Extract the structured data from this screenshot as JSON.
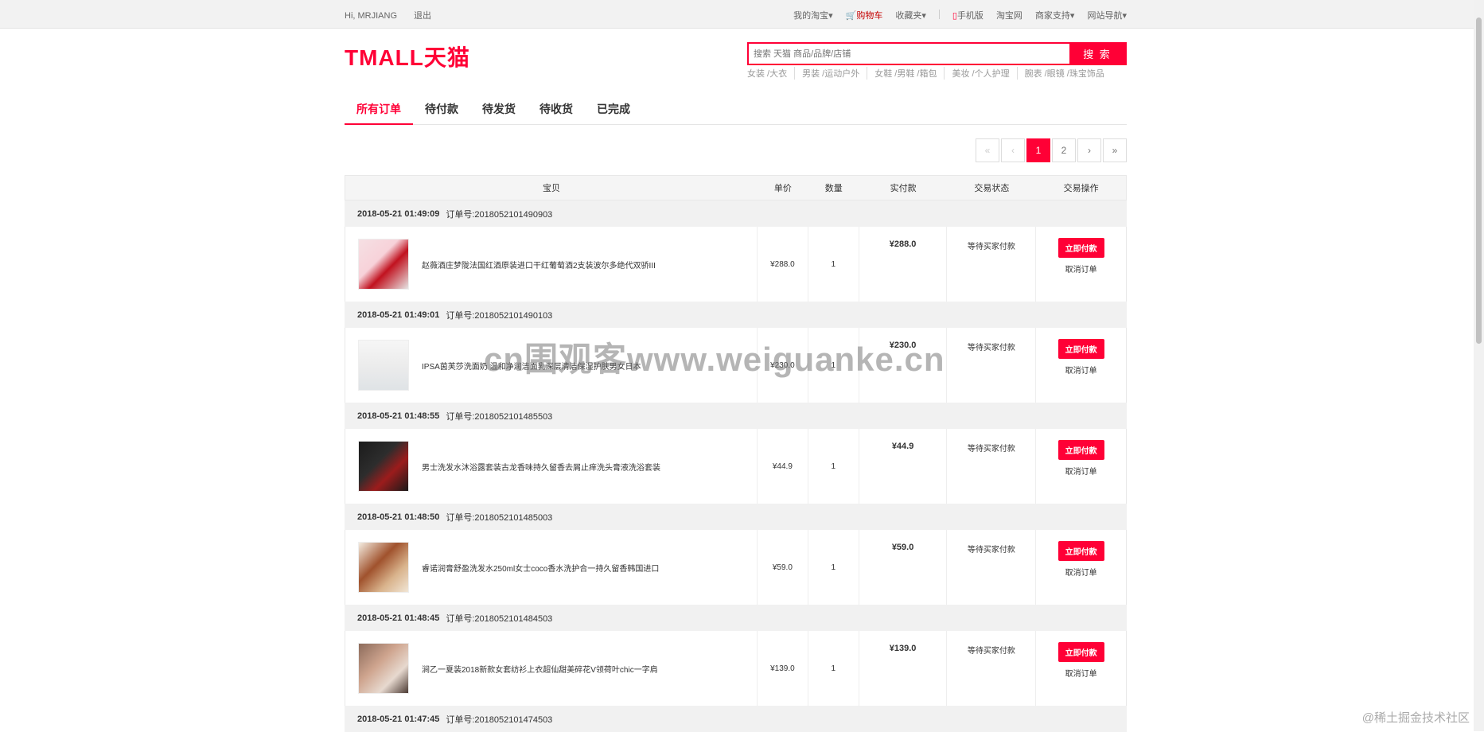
{
  "topbar": {
    "greeting": "Hi, MRJIANG",
    "logout": "退出",
    "links": [
      "我的淘宝▾",
      "购物车",
      "收藏夹▾",
      "手机版",
      "淘宝网",
      "商家支持▾",
      "网站导航▾"
    ]
  },
  "header": {
    "logo": "TMALL天猫",
    "search_placeholder": "搜索 天猫 商品/品牌/店铺",
    "search_button": "搜 索",
    "hotwords": [
      "女装 /大衣",
      "男装 /运动户外",
      "女鞋 /男鞋 /箱包",
      "美妆 /个人护理",
      "腕表 /眼镜 /珠宝饰品"
    ]
  },
  "tabs": [
    "所有订单",
    "待付款",
    "待发货",
    "待收货",
    "已完成"
  ],
  "pagination": [
    "«",
    "‹",
    "1",
    "2",
    "›",
    "»"
  ],
  "table": {
    "headers": [
      "宝贝",
      "单价",
      "数量",
      "实付款",
      "交易状态",
      "交易操作"
    ]
  },
  "orders": [
    {
      "time": "2018-05-21 01:49:09",
      "order_no": "订单号:2018052101490903",
      "title": "赵薇酒庄梦陇法国红酒原装进口干红葡萄酒2支装波尔多绝代双骄III",
      "price": "¥288.0",
      "qty": "1",
      "paid": "¥288.0",
      "status": "等待买家付款",
      "pay_button": "立即付款",
      "cancel": "取消订单"
    },
    {
      "time": "2018-05-21 01:49:01",
      "order_no": "订单号:2018052101490103",
      "title": "IPSA茵芙莎洗面奶 温和净润洁面乳深层清洁保湿护肤男女日本",
      "price": "¥230.0",
      "qty": "1",
      "paid": "¥230.0",
      "status": "等待买家付款",
      "pay_button": "立即付款",
      "cancel": "取消订单"
    },
    {
      "time": "2018-05-21 01:48:55",
      "order_no": "订单号:2018052101485503",
      "title": "男士洗发水沐浴露套装古龙香味持久留香去屑止痒洗头膏液洗浴套装",
      "price": "¥44.9",
      "qty": "1",
      "paid": "¥44.9",
      "status": "等待买家付款",
      "pay_button": "立即付款",
      "cancel": "取消订单"
    },
    {
      "time": "2018-05-21 01:48:50",
      "order_no": "订单号:2018052101485003",
      "title": "睿诺润膏舒盈洗发水250ml女士coco香水洗护合一持久留香韩国进口",
      "price": "¥59.0",
      "qty": "1",
      "paid": "¥59.0",
      "status": "等待买家付款",
      "pay_button": "立即付款",
      "cancel": "取消订单"
    },
    {
      "time": "2018-05-21 01:48:45",
      "order_no": "订单号:2018052101484503",
      "title": "涧乙一夏装2018新款女套纺衫上衣超仙甜美碎花V领荷叶chic一字肩",
      "price": "¥139.0",
      "qty": "1",
      "paid": "¥139.0",
      "status": "等待买家付款",
      "pay_button": "立即付款",
      "cancel": "取消订单"
    },
    {
      "time": "2018-05-21 01:47:45",
      "order_no": "订单号:2018052101474503"
    }
  ],
  "watermark": "cn围观客www.weiguanke.cn",
  "corner_mark": "@稀土掘金技术社区",
  "colors": {
    "accent": "#ff0036"
  }
}
